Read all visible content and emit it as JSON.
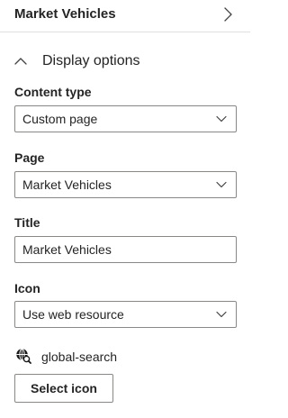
{
  "header": {
    "title": "Market Vehicles"
  },
  "section": {
    "title": "Display options",
    "expanded": true
  },
  "fields": {
    "content_type": {
      "label": "Content type",
      "value": "Custom page"
    },
    "page": {
      "label": "Page",
      "value": "Market Vehicles"
    },
    "title": {
      "label": "Title",
      "value": "Market Vehicles"
    },
    "icon": {
      "label": "Icon",
      "value": "Use web resource"
    }
  },
  "web_resource": {
    "icon_name": "global-search",
    "label": "global-search"
  },
  "buttons": {
    "select_icon": "Select icon"
  }
}
